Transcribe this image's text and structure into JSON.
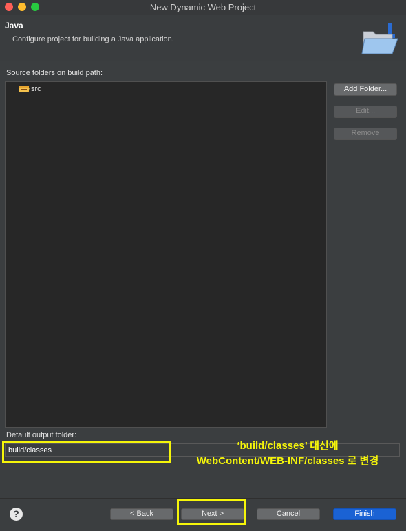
{
  "window": {
    "title": "New Dynamic Web Project"
  },
  "header": {
    "title": "Java",
    "description": "Configure project for building a Java application.",
    "icon": "folder-icon"
  },
  "source": {
    "label": "Source folders on build path:",
    "items": [
      {
        "label": "src",
        "icon": "source-folder-icon"
      }
    ]
  },
  "side_buttons": {
    "add_folder": "Add Folder...",
    "edit": "Edit...",
    "remove": "Remove"
  },
  "output": {
    "label": "Default output folder:",
    "value": "build/classes"
  },
  "annotation": {
    "line1": "‘build/classes’ 대신에",
    "line2": "WebContent/WEB-INF/classes 로 변경",
    "color": "#f5f50a"
  },
  "footer": {
    "help": "?",
    "back": "< Back",
    "next": "Next >",
    "cancel": "Cancel",
    "finish": "Finish"
  },
  "colors": {
    "background": "#3b3e40",
    "accent": "#1a62d4",
    "highlight": "#f5f50a"
  }
}
